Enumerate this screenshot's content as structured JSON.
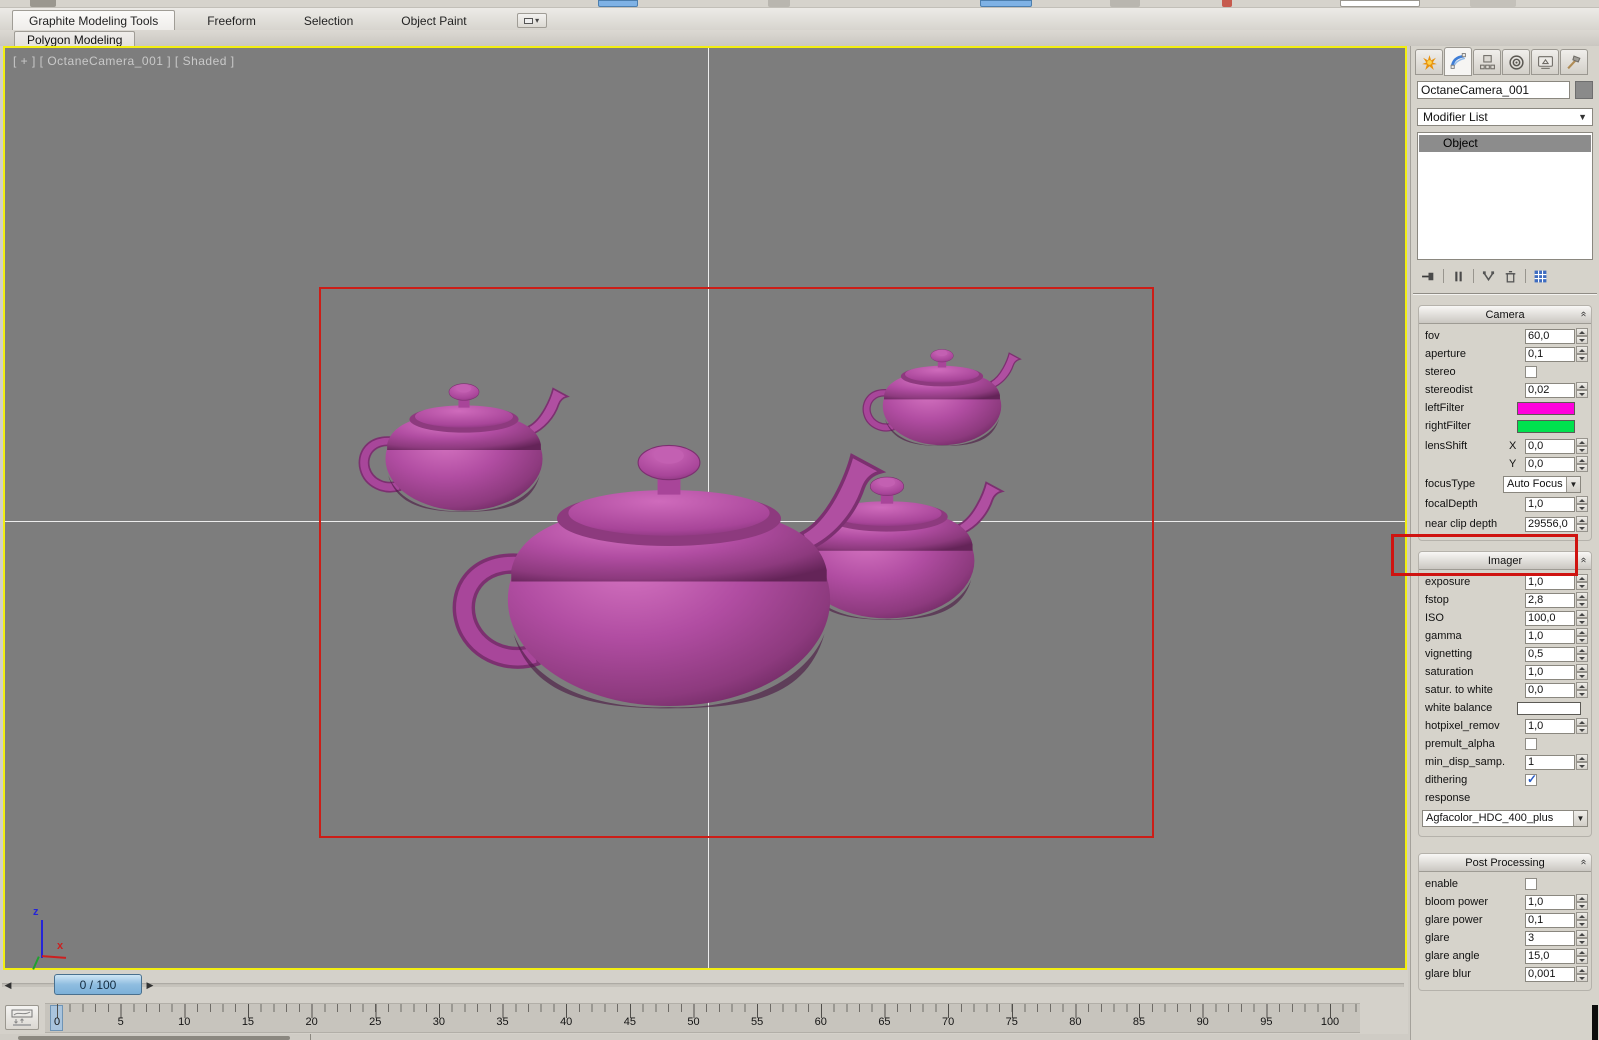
{
  "ribbon": {
    "tabs": [
      "Graphite Modeling Tools",
      "Freeform",
      "Selection",
      "Object Paint"
    ],
    "active_tab": "Graphite Modeling Tools",
    "subtab": "Polygon Modeling"
  },
  "viewport": {
    "label": "[ + ] [ OctaneCamera_001 ] [ Shaded ]",
    "axis": {
      "x": "x",
      "z": "z"
    },
    "colors": {
      "background": "#7d7d7d",
      "active_border": "#f2ee12",
      "safe_frame": "#cc1d17",
      "crosshair": "#ededed",
      "teapot": "#b14da2",
      "annotation_highlight": "#cf1310"
    }
  },
  "command_panel": {
    "tabs": [
      "create",
      "modify",
      "hierarchy",
      "motion",
      "display",
      "utilities"
    ],
    "active_tab": "modify",
    "object_name": "OctaneCamera_001",
    "modifier_list_label": "Modifier List",
    "stack": [
      "Object"
    ],
    "stack_tools": [
      "pin-stack",
      "show-end-result",
      "make-unique",
      "remove-modifier",
      "configure-modifier-sets"
    ],
    "rollouts": [
      {
        "title": "Camera",
        "rows": [
          {
            "label": "fov",
            "type": "spinner",
            "value": "60,0"
          },
          {
            "label": "aperture",
            "type": "spinner",
            "value": "0,1"
          },
          {
            "label": "stereo",
            "type": "checkbox",
            "checked": false
          },
          {
            "label": "stereodist",
            "type": "spinner",
            "value": "0,02"
          },
          {
            "label": "leftFilter",
            "type": "swatch",
            "color": "#ff00dd"
          },
          {
            "label": "rightFilter",
            "type": "swatch",
            "color": "#00e24e"
          },
          {
            "label": "lensShift",
            "sub": "X",
            "type": "spinner",
            "value": "0,0",
            "gap": true
          },
          {
            "label": "",
            "sub": "Y",
            "type": "spinner",
            "value": "0,0"
          },
          {
            "label": "focusType",
            "type": "dropdown",
            "value": "Auto Focus",
            "gap": true
          },
          {
            "label": "focalDepth",
            "type": "spinner",
            "value": "1,0",
            "gap": true
          },
          {
            "label": "near clip depth",
            "type": "spinner",
            "value": "29556,0",
            "gap": true,
            "highlighted": true
          }
        ]
      },
      {
        "title": "Imager",
        "rows": [
          {
            "label": "exposure",
            "type": "spinner",
            "value": "1,0"
          },
          {
            "label": "fstop",
            "type": "spinner",
            "value": "2,8"
          },
          {
            "label": "ISO",
            "type": "spinner",
            "value": "100,0"
          },
          {
            "label": "gamma",
            "type": "spinner",
            "value": "1,0"
          },
          {
            "label": "vignetting",
            "type": "spinner",
            "value": "0,5"
          },
          {
            "label": "saturation",
            "type": "spinner",
            "value": "1,0"
          },
          {
            "label": "satur. to white",
            "type": "spinner",
            "value": "0,0"
          },
          {
            "label": "white balance",
            "type": "swatch",
            "color": "#ffffff",
            "wide": true
          },
          {
            "label": "hotpixel_remov",
            "type": "spinner",
            "value": "1,0"
          },
          {
            "label": "premult_alpha",
            "type": "checkbox",
            "checked": false
          },
          {
            "label": "min_disp_samp.",
            "type": "spinner",
            "value": "1"
          },
          {
            "label": "dithering",
            "type": "checkbox",
            "checked": true
          },
          {
            "label": "response",
            "type": "label"
          },
          {
            "type": "dropdown_wide",
            "value": "Agfacolor_HDC_400_plus"
          }
        ]
      },
      {
        "title": "Post Processing",
        "gap_before": true,
        "rows": [
          {
            "label": "enable",
            "type": "checkbox",
            "checked": false
          },
          {
            "label": "bloom power",
            "type": "spinner",
            "value": "1,0"
          },
          {
            "label": "glare power",
            "type": "spinner",
            "value": "0,1"
          },
          {
            "label": "glare",
            "type": "spinner",
            "value": "3"
          },
          {
            "label": "glare angle",
            "type": "spinner",
            "value": "15,0"
          },
          {
            "label": "glare blur",
            "type": "spinner",
            "value": "0,001"
          }
        ]
      }
    ]
  },
  "timeline": {
    "slider_label": "0 / 100",
    "current_frame": "0",
    "tick_labels": [
      "0",
      "5",
      "10",
      "15",
      "20",
      "25",
      "30",
      "35",
      "40",
      "45",
      "50",
      "55",
      "60",
      "65",
      "70",
      "75",
      "80",
      "85",
      "90",
      "95",
      "100"
    ]
  },
  "icons": {
    "create": "sunburst",
    "modify": "blue-arc",
    "hierarchy": "linked-boxes",
    "motion": "concentric-circles",
    "display": "monitor",
    "utilities": "hammer",
    "ribbon_more": "overflow-dropdown",
    "mini_curve_editor": "curve-with-arrows"
  }
}
